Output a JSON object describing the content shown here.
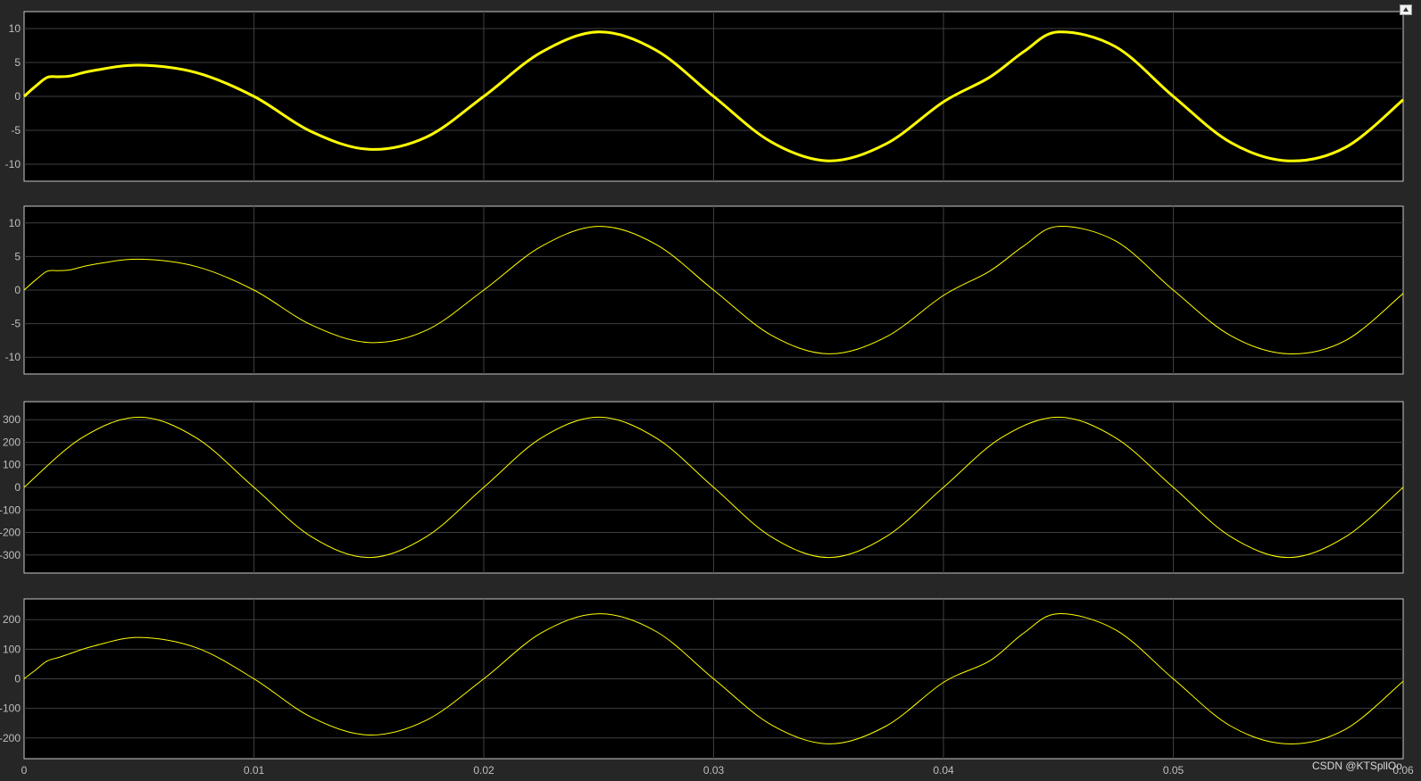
{
  "window": {
    "undock_button": "undock-icon"
  },
  "watermark": "CSDN @KTSpllOo",
  "colors": {
    "background": "#262626",
    "axes": "#000000",
    "grid": "#3f3f3f",
    "trace": "#ffff00",
    "text": "#bfbfbf",
    "frame": "#c8c8c8"
  },
  "chart_data": [
    {
      "type": "line",
      "xlim": [
        0,
        0.06
      ],
      "ylim": [
        -12.5,
        12.5
      ],
      "yticks": [
        10,
        5,
        0,
        -5,
        -10
      ],
      "grid": true,
      "series": [
        {
          "x": [
            0,
            0.0005,
            0.001,
            0.0015,
            0.002,
            0.003,
            0.005,
            0.0075,
            0.01,
            0.0125,
            0.015,
            0.0175,
            0.02,
            0.0225,
            0.025,
            0.0275,
            0.03,
            0.0325,
            0.035,
            0.0375,
            0.04,
            0.042,
            0.0435,
            0.045,
            0.0475,
            0.05,
            0.0525,
            0.055,
            0.0575,
            0.06
          ],
          "y": [
            0,
            1.5,
            2.8,
            2.9,
            3.0,
            3.8,
            4.6,
            3.5,
            0,
            -5.2,
            -7.8,
            -6.0,
            0,
            6.5,
            9.5,
            6.8,
            0,
            -6.7,
            -9.5,
            -7.0,
            -0.8,
            2.8,
            6.6,
            9.5,
            7.3,
            0,
            -6.8,
            -9.5,
            -7.5,
            -0.5
          ]
        }
      ]
    },
    {
      "type": "line",
      "xlim": [
        0,
        0.06
      ],
      "ylim": [
        -12.5,
        12.5
      ],
      "yticks": [
        10,
        5,
        0,
        -5,
        -10
      ],
      "grid": true,
      "series": [
        {
          "x": [
            0,
            0.0005,
            0.001,
            0.0015,
            0.002,
            0.003,
            0.005,
            0.0075,
            0.01,
            0.0125,
            0.015,
            0.0175,
            0.02,
            0.0225,
            0.025,
            0.0275,
            0.03,
            0.0325,
            0.035,
            0.0375,
            0.04,
            0.042,
            0.0435,
            0.045,
            0.0475,
            0.05,
            0.0525,
            0.055,
            0.0575,
            0.06
          ],
          "y": [
            0,
            1.5,
            2.8,
            2.9,
            3.0,
            3.8,
            4.6,
            3.5,
            0,
            -5.2,
            -7.8,
            -6.0,
            0,
            6.5,
            9.5,
            6.8,
            0,
            -6.7,
            -9.5,
            -7.0,
            -0.8,
            2.8,
            6.6,
            9.5,
            7.3,
            0,
            -6.8,
            -9.5,
            -7.5,
            -0.5
          ]
        }
      ]
    },
    {
      "type": "line",
      "xlim": [
        0,
        0.06
      ],
      "ylim": [
        -380,
        380
      ],
      "yticks": [
        300,
        200,
        100,
        0,
        -100,
        -200,
        -300
      ],
      "grid": true,
      "series": [
        {
          "x": [
            0,
            0.0025,
            0.005,
            0.0075,
            0.01,
            0.0125,
            0.015,
            0.0175,
            0.02,
            0.0225,
            0.025,
            0.0275,
            0.03,
            0.0325,
            0.035,
            0.0375,
            0.04,
            0.0425,
            0.045,
            0.0475,
            0.05,
            0.0525,
            0.055,
            0.0575,
            0.06
          ],
          "y": [
            0,
            219,
            311,
            219,
            0,
            -219,
            -311,
            -219,
            0,
            219,
            311,
            219,
            0,
            -219,
            -311,
            -219,
            0,
            219,
            311,
            219,
            0,
            -219,
            -311,
            -219,
            0
          ]
        }
      ]
    },
    {
      "type": "line",
      "xlim": [
        0,
        0.06
      ],
      "ylim": [
        -270,
        270
      ],
      "yticks": [
        200,
        100,
        0,
        -100,
        -200
      ],
      "grid": true,
      "series": [
        {
          "x": [
            0,
            0.0005,
            0.001,
            0.0015,
            0.002,
            0.003,
            0.005,
            0.0075,
            0.01,
            0.0125,
            0.015,
            0.0175,
            0.02,
            0.0225,
            0.025,
            0.0275,
            0.03,
            0.0325,
            0.035,
            0.0375,
            0.04,
            0.042,
            0.0435,
            0.045,
            0.0475,
            0.05,
            0.0525,
            0.055,
            0.0575,
            0.06
          ],
          "y": [
            0,
            30,
            60,
            72,
            85,
            110,
            140,
            105,
            0,
            -130,
            -190,
            -140,
            0,
            155,
            220,
            160,
            0,
            -155,
            -220,
            -160,
            -12,
            60,
            155,
            220,
            165,
            0,
            -160,
            -220,
            -170,
            -8
          ]
        }
      ]
    }
  ],
  "xaxis": {
    "ticks": [
      0,
      0.01,
      0.02,
      0.03,
      0.04,
      0.05
    ],
    "tick_labels": [
      "0",
      "0.01",
      "0.02",
      "0.03",
      "0.04",
      "0.05",
      "0.06"
    ]
  }
}
